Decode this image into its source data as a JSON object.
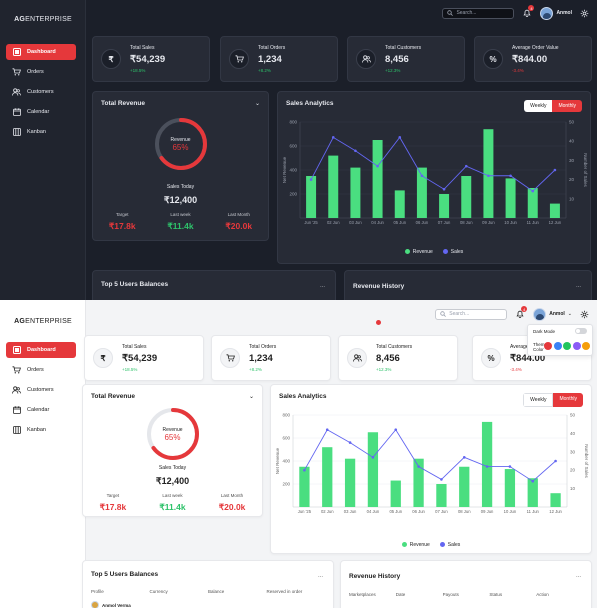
{
  "brand": {
    "bold": "AG",
    "rest": "ENTERPRISE"
  },
  "nav": [
    {
      "label": "Dashboard",
      "icon": "dashboard-icon"
    },
    {
      "label": "Orders",
      "icon": "cart-icon"
    },
    {
      "label": "Customers",
      "icon": "users-icon"
    },
    {
      "label": "Calendar",
      "icon": "calendar-icon"
    },
    {
      "label": "Kanban",
      "icon": "kanban-icon"
    }
  ],
  "topbar": {
    "search_placeholder": "Search...",
    "notif_count": "4",
    "user": "Anmol"
  },
  "stats": [
    {
      "label": "Total Sales",
      "value": "₹54,239",
      "change": "+18.5%",
      "trend": "up",
      "icon": "₹"
    },
    {
      "label": "Total Orders",
      "value": "1,234",
      "change": "+8.2%",
      "trend": "up",
      "icon": "cart"
    },
    {
      "label": "Total Customers",
      "value": "8,456",
      "change": "+12.3%",
      "trend": "up",
      "icon": "users"
    },
    {
      "label": "Average Order Value",
      "value": "₹844.00",
      "change": "-3.4%",
      "trend": "down",
      "icon": "%"
    }
  ],
  "revenue": {
    "title": "Total Revenue",
    "ring_label": "Revenue",
    "percent": "65%",
    "percent_value": 65,
    "today_label": "Sales Today",
    "today_value": "₹12,400",
    "items": [
      {
        "label": "Target",
        "value": "₹17.8k",
        "color": "down"
      },
      {
        "label": "Last week",
        "value": "₹11.4k",
        "color": "up"
      },
      {
        "label": "Last Month",
        "value": "₹20.0k",
        "color": "down"
      }
    ]
  },
  "analytics": {
    "title": "Sales Analytics",
    "weekly": "Weekly",
    "monthly": "Monthly"
  },
  "chart_data": {
    "type": "bar",
    "title": "Sales Analytics",
    "categories": [
      "Jun '25",
      "02 Jun",
      "03 Jun",
      "04 Jun",
      "05 Jun",
      "06 Jun",
      "07 Jun",
      "08 Jun",
      "09 Jun",
      "10 Jun",
      "11 Jun",
      "12 Jun"
    ],
    "series": [
      {
        "name": "Revenue",
        "type": "bar",
        "axis": "left",
        "values": [
          350,
          520,
          420,
          650,
          230,
          420,
          200,
          350,
          740,
          330,
          250,
          120
        ]
      },
      {
        "name": "Sales",
        "type": "line",
        "axis": "right",
        "values": [
          20,
          42,
          35,
          27,
          42,
          22,
          15,
          27,
          22,
          22,
          14,
          25
        ]
      }
    ],
    "ylabel_left": "Net Revenue",
    "ylabel_right": "Number of Sales",
    "ylim_left": [
      0,
      800
    ],
    "yticks_left": [
      200,
      400,
      600,
      800
    ],
    "ylim_right": [
      0,
      50
    ],
    "yticks_right": [
      10,
      20,
      30,
      40,
      50
    ],
    "legend": "bottom-center",
    "colors": {
      "Revenue": "#4ade80",
      "Sales": "#6366f1"
    }
  },
  "balances": {
    "title": "Top 5 Users Balances",
    "columns": [
      "Profile",
      "Currency",
      "Balance",
      "Reserved in order"
    ],
    "first_user": "Anmol Verma"
  },
  "history": {
    "title": "Revenue History",
    "columns": [
      "Marketplaces",
      "Date",
      "Payouts",
      "Status",
      "Action"
    ]
  },
  "settings": {
    "dark_mode": "Dark Mode",
    "theme": "Theme",
    "color": "Color",
    "swatches": [
      "#e5383b",
      "#3b82f6",
      "#22c55e",
      "#8b5cf6",
      "#f59e0b"
    ]
  },
  "more": "..."
}
